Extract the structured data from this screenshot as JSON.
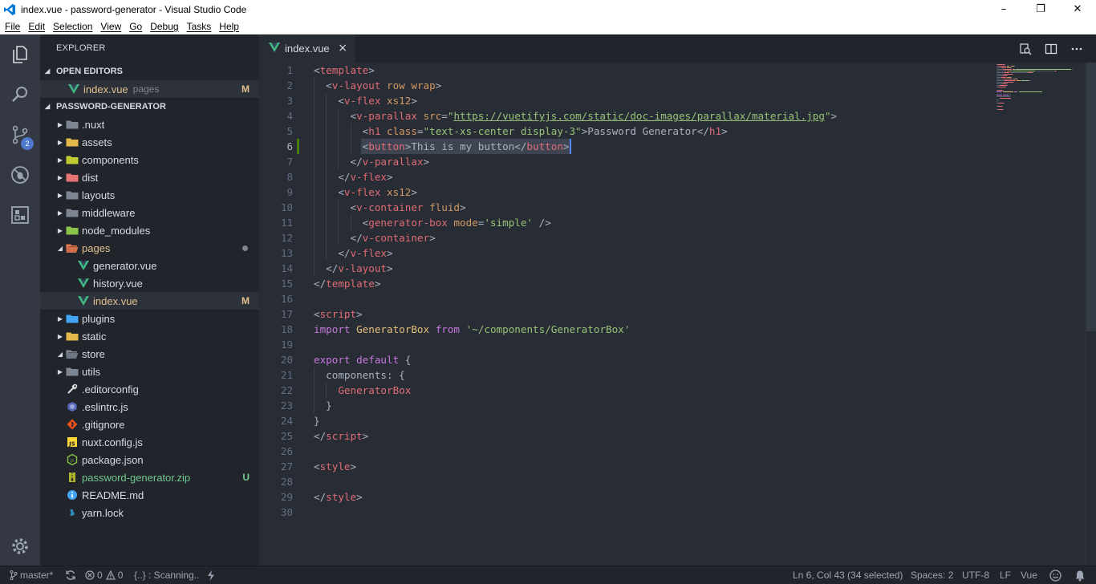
{
  "window": {
    "title": "index.vue - password-generator - Visual Studio Code",
    "minimize": "–",
    "maximize": "❐",
    "close": "✕"
  },
  "menu": [
    "File",
    "Edit",
    "Selection",
    "View",
    "Go",
    "Debug",
    "Tasks",
    "Help"
  ],
  "activity_bar": {
    "items": [
      "files-icon",
      "search-icon",
      "source-control-icon",
      "debug-icon",
      "extensions-icon"
    ],
    "source_control_badge": "2",
    "settings": "gear-icon"
  },
  "explorer": {
    "title": "EXPLORER",
    "open_editors": {
      "header": "OPEN EDITORS",
      "files": [
        {
          "name": "index.vue",
          "desc": "pages",
          "status": "M"
        }
      ]
    },
    "project": {
      "header": "PASSWORD-GENERATOR",
      "items": [
        {
          "name": ".nuxt",
          "kind": "folder",
          "icon": "folder-nuxt-icon"
        },
        {
          "name": "assets",
          "kind": "folder",
          "icon": "folder-assets-icon"
        },
        {
          "name": "components",
          "kind": "folder",
          "icon": "folder-components-icon"
        },
        {
          "name": "dist",
          "kind": "folder",
          "icon": "folder-dist-icon"
        },
        {
          "name": "layouts",
          "kind": "folder",
          "icon": "folder-layouts-icon"
        },
        {
          "name": "middleware",
          "kind": "folder",
          "icon": "folder-middleware-icon"
        },
        {
          "name": "node_modules",
          "kind": "folder",
          "icon": "folder-node-icon"
        },
        {
          "name": "pages",
          "kind": "folder-open",
          "icon": "folder-pages-icon",
          "modified_dot": true
        },
        {
          "name": "generator.vue",
          "kind": "vue-file",
          "icon": "vue-icon"
        },
        {
          "name": "history.vue",
          "kind": "vue-file",
          "icon": "vue-icon"
        },
        {
          "name": "index.vue",
          "kind": "vue-file",
          "icon": "vue-icon",
          "status": "M"
        },
        {
          "name": "plugins",
          "kind": "folder",
          "icon": "folder-plugins-icon"
        },
        {
          "name": "static",
          "kind": "folder",
          "icon": "folder-static-icon"
        },
        {
          "name": "store",
          "kind": "folder-open",
          "icon": "folder-store-icon"
        },
        {
          "name": "utils",
          "kind": "folder",
          "icon": "folder-utils-icon"
        },
        {
          "name": ".editorconfig",
          "kind": "file",
          "icon": "editorconfig-icon"
        },
        {
          "name": ".eslintrc.js",
          "kind": "file",
          "icon": "eslint-icon"
        },
        {
          "name": ".gitignore",
          "kind": "file",
          "icon": "git-icon"
        },
        {
          "name": "nuxt.config.js",
          "kind": "file",
          "icon": "js-icon"
        },
        {
          "name": "package.json",
          "kind": "file",
          "icon": "nodejs-icon"
        },
        {
          "name": "password-generator.zip",
          "kind": "file",
          "icon": "zip-icon",
          "status": "U"
        },
        {
          "name": "README.md",
          "kind": "file",
          "icon": "info-icon"
        },
        {
          "name": "yarn.lock",
          "kind": "file",
          "icon": "yarn-icon"
        }
      ]
    }
  },
  "editor": {
    "tab": {
      "label": "index.vue",
      "close": "×"
    },
    "actions": [
      "open-changes-icon",
      "split-editor-icon",
      "more-icon"
    ],
    "lines": [
      [
        [
          "t-plain",
          "<"
        ],
        [
          "t-tag",
          "template"
        ],
        [
          "t-plain",
          ">"
        ]
      ],
      [
        [
          "t-plain",
          "  <"
        ],
        [
          "t-tag",
          "v-layout"
        ],
        [
          "t-plain",
          " "
        ],
        [
          "t-attr",
          "row"
        ],
        [
          "t-plain",
          " "
        ],
        [
          "t-attr",
          "wrap"
        ],
        [
          "t-plain",
          ">"
        ]
      ],
      [
        [
          "t-plain",
          "    <"
        ],
        [
          "t-tag",
          "v-flex"
        ],
        [
          "t-plain",
          " "
        ],
        [
          "t-attr",
          "xs12"
        ],
        [
          "t-plain",
          ">"
        ]
      ],
      [
        [
          "t-plain",
          "      <"
        ],
        [
          "t-tag",
          "v-parallax"
        ],
        [
          "t-plain",
          " "
        ],
        [
          "t-attr",
          "src"
        ],
        [
          "t-plain",
          "="
        ],
        [
          "t-str",
          "\""
        ],
        [
          "t-url",
          "https://vuetifyjs.com/static/doc-images/parallax/material.jpg"
        ],
        [
          "t-str",
          "\""
        ],
        [
          "t-plain",
          ">"
        ]
      ],
      [
        [
          "t-plain",
          "        <"
        ],
        [
          "t-tag",
          "h1"
        ],
        [
          "t-plain",
          " "
        ],
        [
          "t-attr",
          "class"
        ],
        [
          "t-plain",
          "="
        ],
        [
          "t-str",
          "\"text-xs-center display-3\""
        ],
        [
          "t-plain",
          ">Password Generator</"
        ],
        [
          "t-tag",
          "h1"
        ],
        [
          "t-plain",
          ">"
        ]
      ],
      [
        [
          "t-plain",
          "        <"
        ],
        [
          "t-tag",
          "button"
        ],
        [
          "t-plain",
          ">This is my button</"
        ],
        [
          "t-tag",
          "button"
        ],
        [
          "t-plain",
          ">"
        ]
      ],
      [
        [
          "t-plain",
          "      </"
        ],
        [
          "t-tag",
          "v-parallax"
        ],
        [
          "t-plain",
          ">"
        ]
      ],
      [
        [
          "t-plain",
          "    </"
        ],
        [
          "t-tag",
          "v-flex"
        ],
        [
          "t-plain",
          ">"
        ]
      ],
      [
        [
          "t-plain",
          "    <"
        ],
        [
          "t-tag",
          "v-flex"
        ],
        [
          "t-plain",
          " "
        ],
        [
          "t-attr",
          "xs12"
        ],
        [
          "t-plain",
          ">"
        ]
      ],
      [
        [
          "t-plain",
          "      <"
        ],
        [
          "t-tag",
          "v-container"
        ],
        [
          "t-plain",
          " "
        ],
        [
          "t-attr",
          "fluid"
        ],
        [
          "t-plain",
          ">"
        ]
      ],
      [
        [
          "t-plain",
          "        <"
        ],
        [
          "t-tag",
          "generator-box"
        ],
        [
          "t-plain",
          " "
        ],
        [
          "t-attr",
          "mode"
        ],
        [
          "t-plain",
          "="
        ],
        [
          "t-str",
          "'simple'"
        ],
        [
          "t-plain",
          " />"
        ]
      ],
      [
        [
          "t-plain",
          "      </"
        ],
        [
          "t-tag",
          "v-container"
        ],
        [
          "t-plain",
          ">"
        ]
      ],
      [
        [
          "t-plain",
          "    </"
        ],
        [
          "t-tag",
          "v-flex"
        ],
        [
          "t-plain",
          ">"
        ]
      ],
      [
        [
          "t-plain",
          "  </"
        ],
        [
          "t-tag",
          "v-layout"
        ],
        [
          "t-plain",
          ">"
        ]
      ],
      [
        [
          "t-plain",
          "</"
        ],
        [
          "t-tag",
          "template"
        ],
        [
          "t-plain",
          ">"
        ]
      ],
      [],
      [
        [
          "t-plain",
          "<"
        ],
        [
          "t-tag",
          "script"
        ],
        [
          "t-plain",
          ">"
        ]
      ],
      [
        [
          "t-kw",
          "import"
        ],
        [
          "t-plain",
          " "
        ],
        [
          "t-ident",
          "GeneratorBox"
        ],
        [
          "t-plain",
          " "
        ],
        [
          "t-kw",
          "from"
        ],
        [
          "t-plain",
          " "
        ],
        [
          "t-str",
          "'~/components/GeneratorBox'"
        ]
      ],
      [],
      [
        [
          "t-kw",
          "export"
        ],
        [
          "t-plain",
          " "
        ],
        [
          "t-kw",
          "default"
        ],
        [
          "t-plain",
          " {"
        ]
      ],
      [
        [
          "t-plain",
          "  components: {"
        ]
      ],
      [
        [
          "t-plain",
          "    "
        ],
        [
          "t-prop",
          "GeneratorBox"
        ]
      ],
      [
        [
          "t-plain",
          "  }"
        ]
      ],
      [
        [
          "t-plain",
          "}"
        ]
      ],
      [
        [
          "t-plain",
          "</"
        ],
        [
          "t-tag",
          "script"
        ],
        [
          "t-plain",
          ">"
        ]
      ],
      [],
      [
        [
          "t-plain",
          "<"
        ],
        [
          "t-tag",
          "style"
        ],
        [
          "t-plain",
          ">"
        ]
      ],
      [],
      [
        [
          "t-plain",
          "</"
        ],
        [
          "t-tag",
          "style"
        ],
        [
          "t-plain",
          ">"
        ]
      ],
      []
    ]
  },
  "statusbar": {
    "branch": "master*",
    "errors": "0",
    "warnings": "0",
    "scanning": "{..} : Scanning..",
    "position": "Ln 6, Col 43 (34 selected)",
    "spaces": "Spaces: 2",
    "encoding": "UTF-8",
    "eol": "LF",
    "language": "Vue"
  },
  "colors": {
    "vue_green": "#41b883",
    "modified": "#e2c08d",
    "untracked": "#73c991",
    "accent": "#4d78cc"
  }
}
